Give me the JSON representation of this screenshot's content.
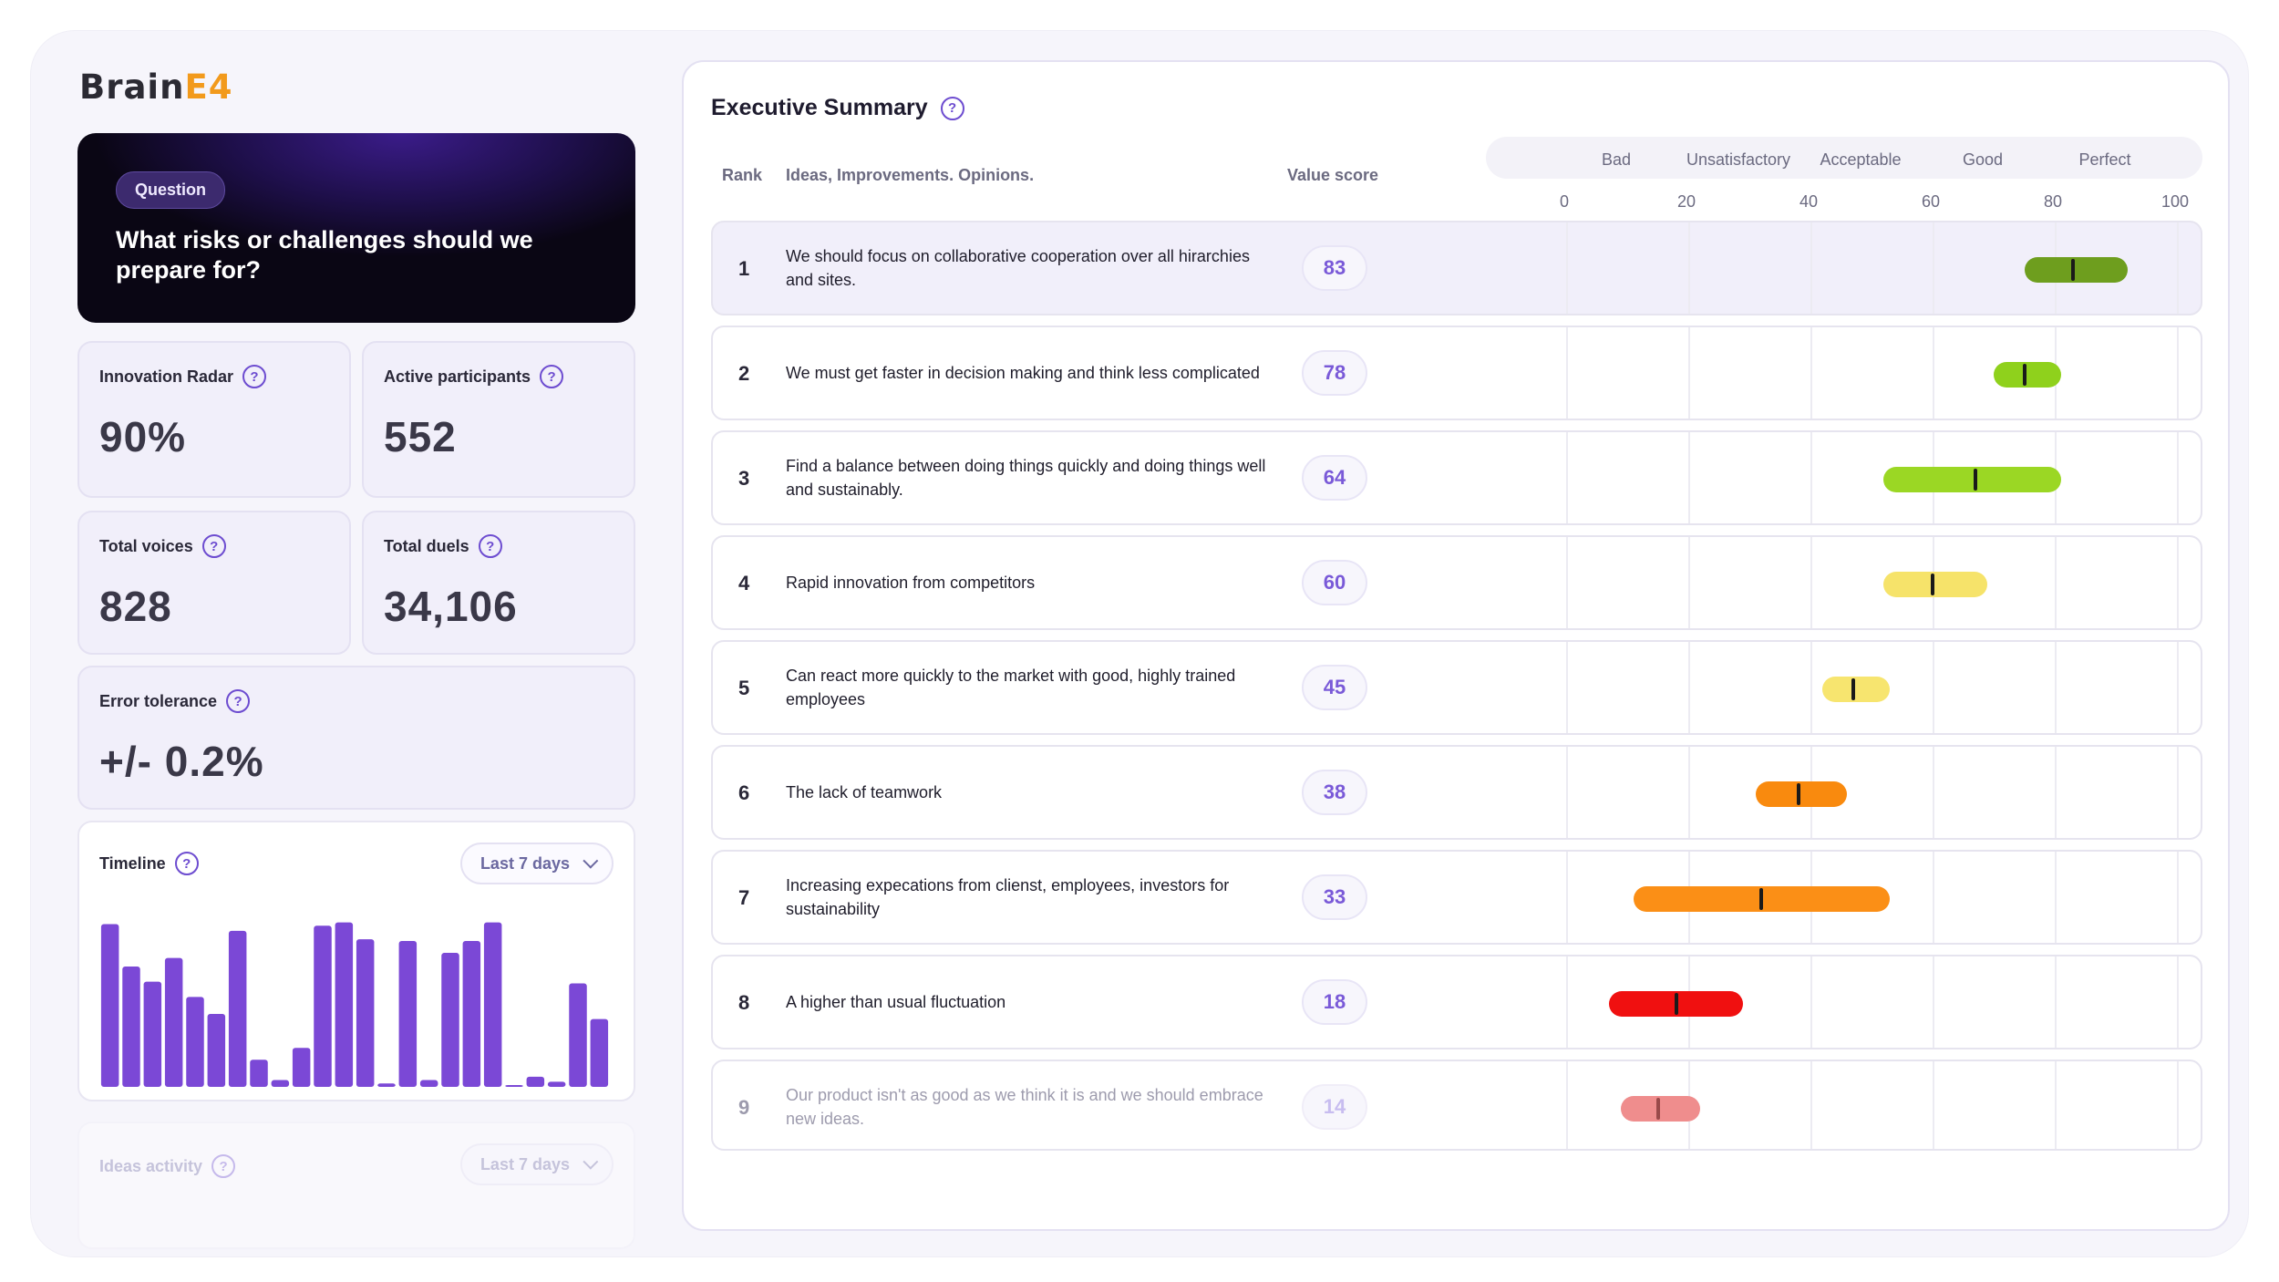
{
  "app": {
    "logo_main": "Brain",
    "logo_accent": "E4"
  },
  "question": {
    "pill": "Question",
    "text": "What risks or challenges should we prepare for?"
  },
  "stats": [
    {
      "label": "Innovation Radar",
      "value": "90%"
    },
    {
      "label": "Active participants",
      "value": "552"
    },
    {
      "label": "Total voices",
      "value": "828"
    },
    {
      "label": "Total duels",
      "value": "34,106"
    },
    {
      "label": "Error tolerance",
      "value": "+/- 0.2%"
    }
  ],
  "timeline": {
    "label": "Timeline",
    "range": "Last 7 days",
    "bar_color": "#7b48d6",
    "bars": [
      96,
      71,
      62,
      76,
      53,
      43,
      92,
      16,
      4,
      23,
      95,
      97,
      87,
      2,
      86,
      4,
      79,
      86,
      97,
      1,
      6,
      3,
      61,
      40
    ]
  },
  "ideas_activity": {
    "label": "Ideas activity",
    "range": "Last 7 days"
  },
  "summary": {
    "title": "Executive Summary",
    "columns": {
      "rank": "Rank",
      "ideas": "Ideas, Improvements. Opinions.",
      "score": "Value score"
    },
    "scale_categories": [
      "Bad",
      "Unsatisfactory",
      "Acceptable",
      "Good",
      "Perfect"
    ],
    "scale_ticks": [
      "0",
      "20",
      "40",
      "60",
      "80",
      "100"
    ],
    "rows": [
      {
        "rank": "1",
        "text": "We should focus on collaborative cooperation over all hirarchies and sites.",
        "score": "83",
        "low": 75,
        "high": 92,
        "mark": 83,
        "color": "#6e9e1e"
      },
      {
        "rank": "2",
        "text": "We must get faster in decision making and think less complicated",
        "score": "78",
        "low": 70,
        "high": 81,
        "mark": 75,
        "color": "#8fd11c"
      },
      {
        "rank": "3",
        "text": "Find a balance between doing things quickly and doing things well and sustainably.",
        "score": "64",
        "low": 52,
        "high": 81,
        "mark": 67,
        "color": "#9bd724"
      },
      {
        "rank": "4",
        "text": "Rapid innovation from competitors",
        "score": "60",
        "low": 52,
        "high": 69,
        "mark": 60,
        "color": "#f6e36a"
      },
      {
        "rank": "5",
        "text": "Can react more quickly to the market with good, highly trained employees",
        "score": "45",
        "low": 42,
        "high": 53,
        "mark": 47,
        "color": "#f7e56f"
      },
      {
        "rank": "6",
        "text": "The lack of teamwork",
        "score": "38",
        "low": 31,
        "high": 46,
        "mark": 38,
        "color": "#f98a0e"
      },
      {
        "rank": "7",
        "text": "Increasing expecations from clienst, employees, investors for sustainability",
        "score": "33",
        "low": 11,
        "high": 53,
        "mark": 32,
        "color": "#fb8f16"
      },
      {
        "rank": "8",
        "text": "A higher than usual fluctuation",
        "score": "18",
        "low": 7,
        "high": 29,
        "mark": 18,
        "color": "#f01010"
      },
      {
        "rank": "9",
        "text": "Our product isn't as good as we think it is and we should embrace new ideas.",
        "score": "14",
        "low": 9,
        "high": 22,
        "mark": 15,
        "color": "#ef8d8d"
      }
    ]
  }
}
